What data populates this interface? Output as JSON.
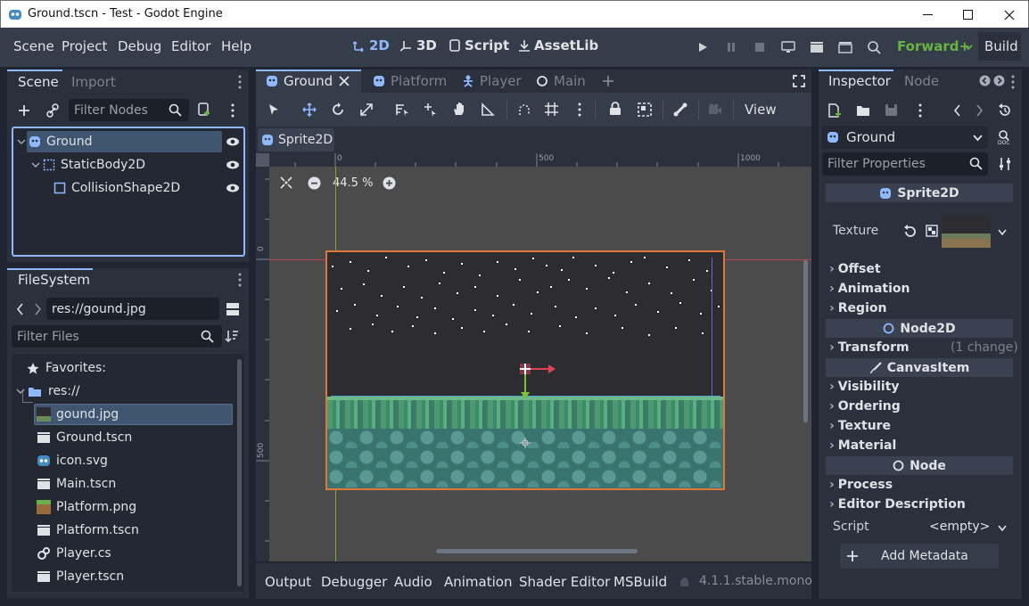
{
  "window": {
    "title": "Ground.tscn - Test - Godot Engine"
  },
  "menu": [
    "Scene",
    "Project",
    "Debug",
    "Editor",
    "Help"
  ],
  "modes": {
    "d2": "2D",
    "d3": "3D",
    "script": "Script",
    "assetlib": "AssetLib"
  },
  "renderer": "Forward+",
  "build": "Build",
  "scene_dock": {
    "tabs": [
      "Scene",
      "Import"
    ],
    "filter_placeholder": "Filter Nodes",
    "nodes": [
      "Ground",
      "StaticBody2D",
      "CollisionShape2D"
    ]
  },
  "filesystem": {
    "tab": "FileSystem",
    "path": "res://gound.jpg",
    "filter_placeholder": "Filter Files",
    "favorites": "Favorites:",
    "root": "res://",
    "files": [
      "gound.jpg",
      "Ground.tscn",
      "icon.svg",
      "Main.tscn",
      "Platform.png",
      "Platform.tscn",
      "Player.cs",
      "Player.tscn"
    ]
  },
  "scene_tabs": [
    "Ground",
    "Platform",
    "Player",
    "Main"
  ],
  "toolbar": {
    "view": "View"
  },
  "breadcrumb": "Sprite2D",
  "viewport": {
    "zoom": "44.5 %",
    "ruler_h": [
      "0",
      "500",
      "1000"
    ],
    "ruler_v": [
      "0",
      "500"
    ]
  },
  "inspector": {
    "tabs": [
      "Inspector",
      "Node"
    ],
    "object": "Ground",
    "filter_placeholder": "Filter Properties",
    "sections": {
      "sprite": "Sprite2D",
      "node2d": "Node2D",
      "canvas": "CanvasItem",
      "node": "Node"
    },
    "texture_label": "Texture",
    "sprite_groups": [
      "Offset",
      "Animation",
      "Region"
    ],
    "transform": "Transform",
    "transform_note": "(1 change)",
    "canvas_groups": [
      "Visibility",
      "Ordering",
      "Texture",
      "Material"
    ],
    "node_groups": [
      "Process",
      "Editor Description"
    ],
    "script_label": "Script",
    "script_value": "<empty>",
    "add_metadata": "Add Metadata"
  },
  "bottom_tabs": [
    "Output",
    "Debugger",
    "Audio",
    "Animation",
    "Shader Editor",
    "MSBuild"
  ],
  "version": "4.1.1.stable.mono",
  "colors": {
    "accent": "#8fb8ff",
    "renderer": "#68b543",
    "selection": "#3f5570",
    "panel": "#2a303c",
    "viewport": "#4b4b4b"
  }
}
